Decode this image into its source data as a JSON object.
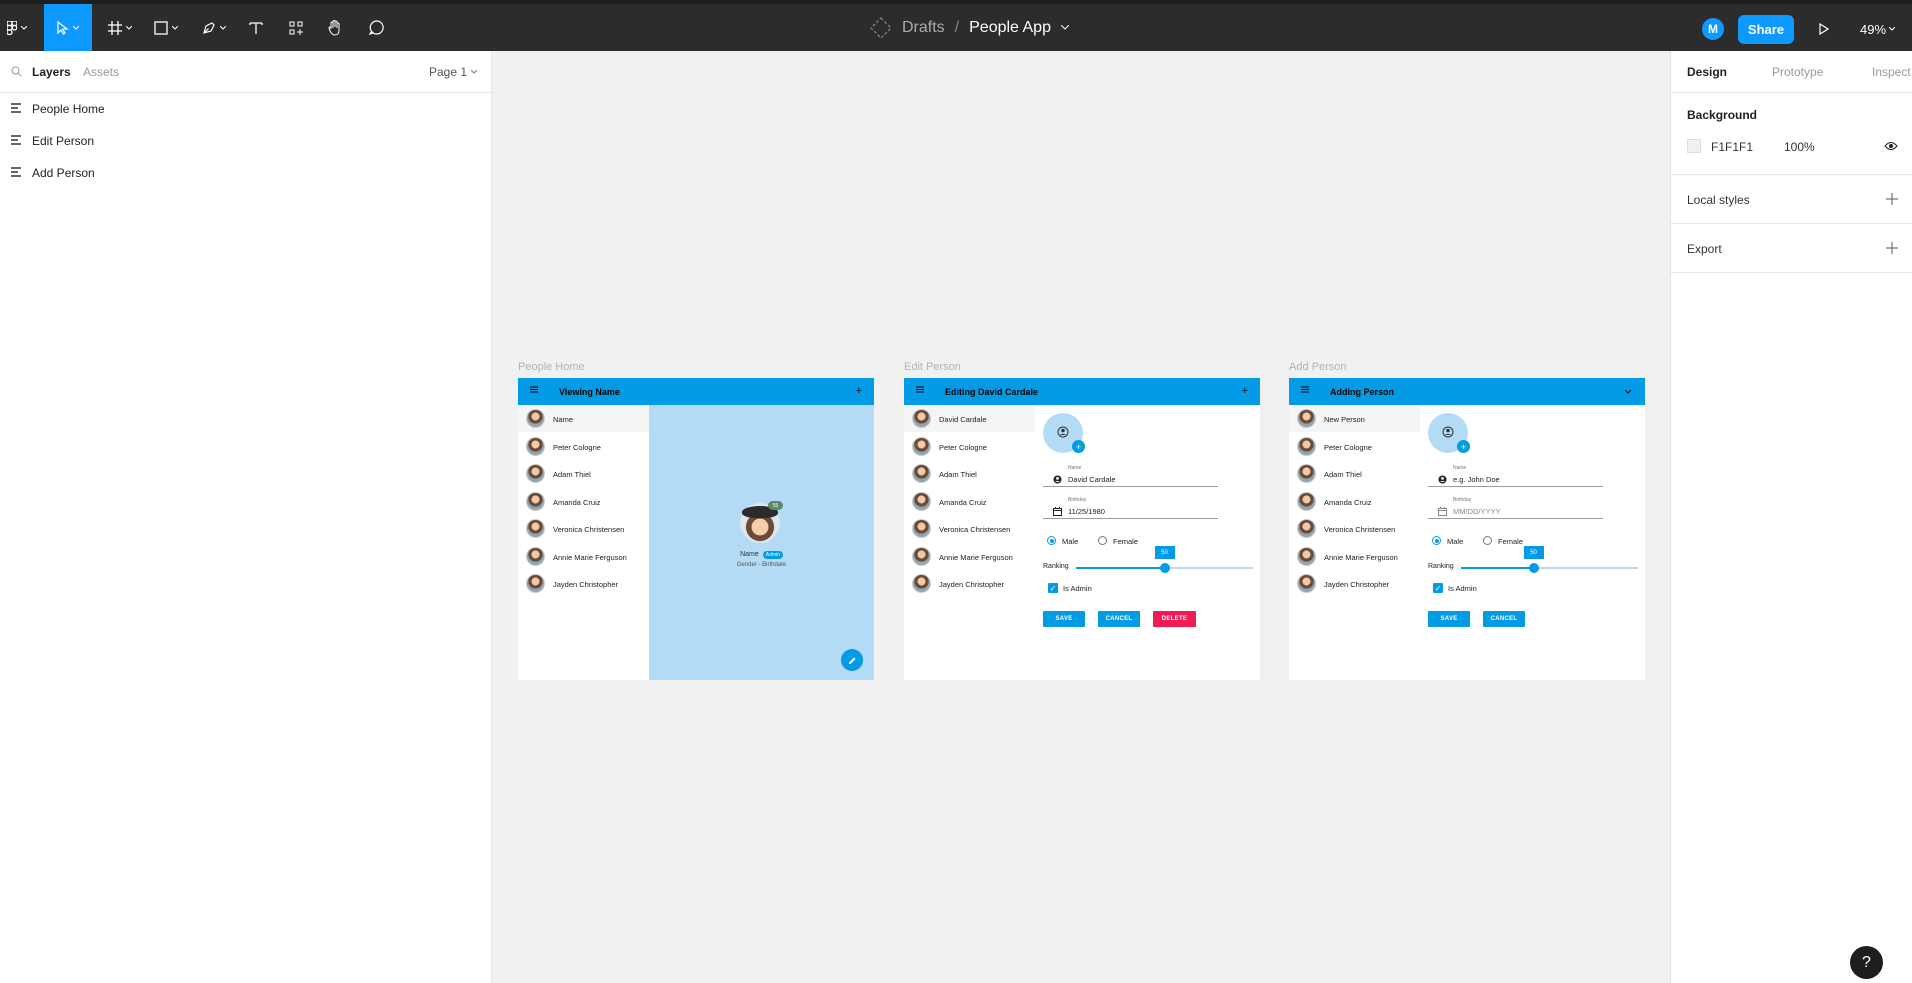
{
  "toolbar": {
    "breadcrumb_folder": "Drafts",
    "breadcrumb_sep": "/",
    "file_name": "People App",
    "user_initial": "M",
    "share_label": "Share",
    "zoom": "49%"
  },
  "layers_panel": {
    "tab_layers": "Layers",
    "tab_assets": "Assets",
    "page": "Page 1",
    "layers": [
      "People Home",
      "Edit Person",
      "Add Person"
    ]
  },
  "design_panel": {
    "tabs": [
      "Design",
      "Prototype",
      "Inspect"
    ],
    "background_title": "Background",
    "bg_hex": "F1F1F1",
    "bg_opacity": "100%",
    "local_styles": "Local styles",
    "export": "Export",
    "help": "?"
  },
  "people": [
    "Peter Cologne",
    "Adam Thiel",
    "Amanda Cruiz",
    "Veronica Christensen",
    "Annie Marie Ferguson",
    "Jayden Christopher"
  ],
  "frame_home": {
    "label": "People Home",
    "title": "Viewing Name",
    "first_item": "Name",
    "detail_name": "Name",
    "detail_badge": "Admin",
    "detail_sub": "Gender - Birthdate",
    "avatar_count": "55"
  },
  "frame_edit": {
    "label": "Edit Person",
    "title": "Editing David Cardale",
    "first_item": "David Cardale",
    "name_label": "Name",
    "name_value": "David Cardale",
    "birthday_label": "Birthday",
    "birthday_value": "11/25/1980",
    "male": "Male",
    "female": "Female",
    "ranking": "Ranking",
    "ranking_value": "50",
    "is_admin": "Is Admin",
    "save": "SAVE",
    "cancel": "CANCEL",
    "delete": "DELETE"
  },
  "frame_add": {
    "label": "Add Person",
    "title": "Adding Person",
    "first_item": "New Person",
    "name_label": "Name",
    "name_placeholder": "e.g. John Doe",
    "birthday_label": "Birthday",
    "birthday_placeholder": "MM/DD/YYYY",
    "male": "Male",
    "female": "Female",
    "ranking": "Ranking",
    "ranking_value": "50",
    "is_admin": "Is Admin",
    "save": "SAVE",
    "cancel": "CANCEL"
  },
  "colors": {
    "figma_blue": "#0d99ff",
    "material_blue": "#039be5",
    "delete_red": "#f21a54",
    "canvas": "#f1f1f1"
  }
}
